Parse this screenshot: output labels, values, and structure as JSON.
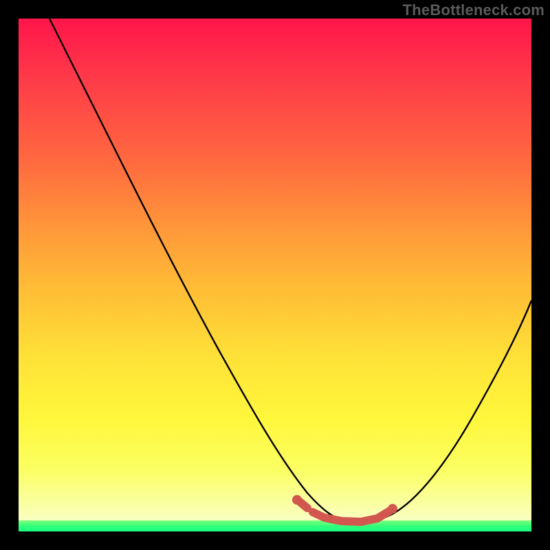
{
  "watermark": "TheBottleneck.com",
  "colors": {
    "background": "#000000",
    "gradient_top": "#ff154a",
    "gradient_mid": "#ffe137",
    "gradient_bottom": "#f8ffd8",
    "green_band": "#2aff7a",
    "curve": "#000000",
    "marker": "#d1574f"
  },
  "chart_data": {
    "type": "line",
    "title": "",
    "xlabel": "",
    "ylabel": "",
    "xlim": [
      0,
      100
    ],
    "ylim": [
      0,
      100
    ],
    "x": [
      0,
      5,
      10,
      15,
      20,
      25,
      30,
      35,
      40,
      45,
      50,
      55,
      58,
      60,
      62,
      64,
      66,
      68,
      70,
      75,
      80,
      85,
      90,
      95,
      100
    ],
    "values": [
      108,
      100,
      90,
      80,
      70,
      60,
      50,
      40,
      31,
      22,
      14,
      8,
      5,
      3,
      2,
      2,
      2,
      2,
      3,
      6,
      12,
      20,
      29,
      38,
      48
    ],
    "annotations": {
      "optimal_range_x": [
        56,
        70
      ],
      "optimal_range_y": 2
    }
  }
}
